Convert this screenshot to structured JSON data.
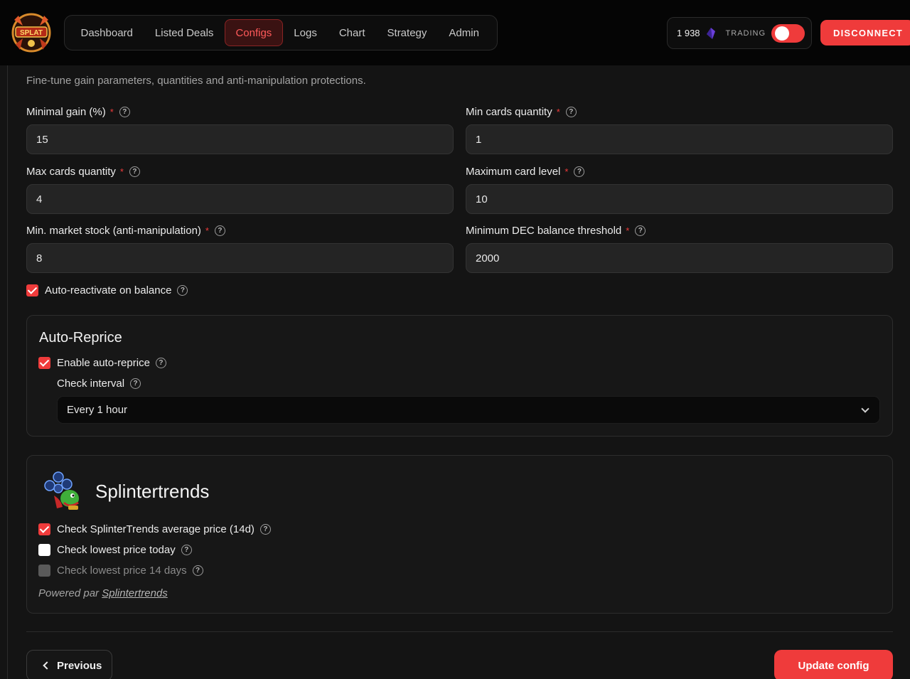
{
  "nav": {
    "items": [
      {
        "label": "Dashboard",
        "active": false
      },
      {
        "label": "Listed Deals",
        "active": false
      },
      {
        "label": "Configs",
        "active": true
      },
      {
        "label": "Logs",
        "active": false
      },
      {
        "label": "Chart",
        "active": false
      },
      {
        "label": "Strategy",
        "active": false
      },
      {
        "label": "Admin",
        "active": false
      }
    ]
  },
  "status": {
    "balance": "1 938",
    "balance_icon": "dec-crystal-icon",
    "trading_label": "TRADING",
    "trading_on": true
  },
  "header": {
    "disconnect_label": "DISCONNECT"
  },
  "colors": {
    "accent": "#ef3b3b",
    "background": "#141414",
    "input_bg": "#242424"
  },
  "form": {
    "subtitle": "Fine-tune gain parameters, quantities and anti-manipulation protections.",
    "required_mark": "*",
    "help_glyph": "?",
    "fields": {
      "minimal_gain": {
        "label": "Minimal gain (%)",
        "value": "15"
      },
      "min_cards_quantity": {
        "label": "Min cards quantity",
        "value": "1"
      },
      "max_cards_quantity": {
        "label": "Max cards quantity",
        "value": "4"
      },
      "maximum_card_level": {
        "label": "Maximum card level",
        "value": "10"
      },
      "min_market_stock": {
        "label": "Min. market stock (anti-manipulation)",
        "value": "8"
      },
      "min_dec_balance": {
        "label": "Minimum DEC balance threshold",
        "value": "2000"
      }
    },
    "auto_reactivate": {
      "label": "Auto-reactivate on balance",
      "checked": true
    }
  },
  "auto_reprice": {
    "title": "Auto-Reprice",
    "enable": {
      "label": "Enable auto-reprice",
      "checked": true
    },
    "interval_label": "Check interval",
    "interval_value": "Every 1 hour"
  },
  "splintertrends": {
    "title": "Splintertrends",
    "options": [
      {
        "label": "Check SplinterTrends average price (14d)",
        "state": "checked"
      },
      {
        "label": "Check lowest price today",
        "state": "unchecked"
      },
      {
        "label": "Check lowest price 14 days",
        "state": "disabled"
      }
    ],
    "powered_prefix": "Powered par",
    "powered_link": "Splintertrends"
  },
  "footer": {
    "previous_label": "Previous",
    "update_label": "Update config"
  }
}
